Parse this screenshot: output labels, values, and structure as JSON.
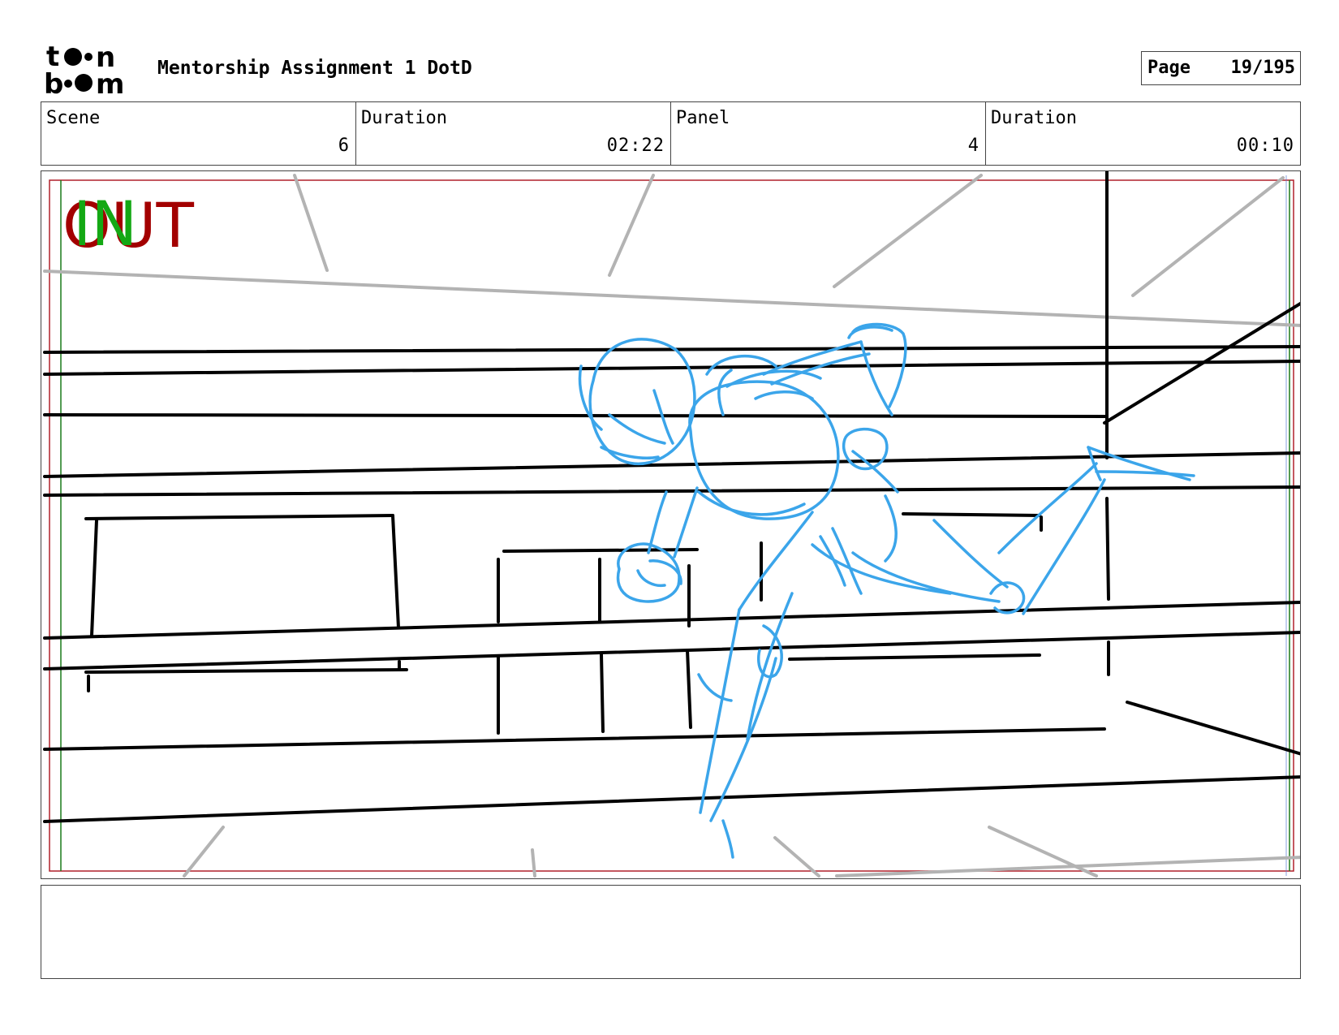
{
  "header": {
    "logo_text": "toon boom",
    "title": "Mentorship Assignment 1 DotD",
    "page_label": "Page",
    "page_number": "19/195"
  },
  "info": [
    {
      "label": "Scene",
      "value": "6"
    },
    {
      "label": "Duration",
      "value": "02:22"
    },
    {
      "label": "Panel",
      "value": "4"
    },
    {
      "label": "Duration",
      "value": "00:10"
    }
  ],
  "panel": {
    "in_mark": "IN",
    "out_mark": "OUT",
    "colors": {
      "out_mark": "#a30000",
      "in_mark": "#14a814",
      "frame_red": "#b0202a",
      "frame_green": "#1a7a1a",
      "frame_blue": "#5a7bd8",
      "sketch_blue": "#3ba5ea",
      "sketch_gray": "#b3b3b3",
      "ink": "#000000"
    }
  },
  "notes": {
    "text": ""
  }
}
